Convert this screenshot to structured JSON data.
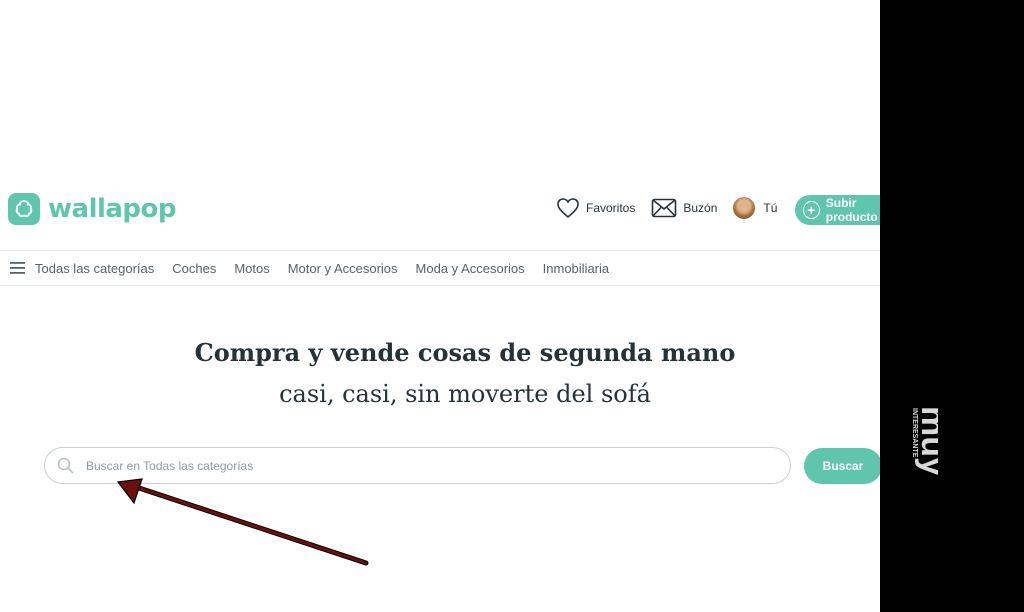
{
  "header": {
    "logo_text": "wallapop",
    "favorites_label": "Favoritos",
    "inbox_label": "Buzón",
    "user_label": "Tú",
    "upload_label": "Subir producto"
  },
  "nav": {
    "all_categories": "Todas las categorías",
    "categories": [
      "Coches",
      "Motos",
      "Motor y Accesorios",
      "Moda y Accesorios",
      "Inmobiliaria"
    ]
  },
  "hero": {
    "title": "Compra y vende cosas de segunda mano",
    "subtitle": "casi, casi, sin moverte del sofá"
  },
  "search": {
    "placeholder": "Buscar en Todas las categorías",
    "value": "",
    "button_label": "Buscar"
  },
  "colors": {
    "brand": "#5fc6ad",
    "arrow": "#6b0f0f",
    "side_bar": "#000000"
  },
  "icons": {
    "logo": "wallapop-logo-icon",
    "favorites": "heart-icon",
    "inbox": "envelope-icon",
    "menu": "hamburger-icon",
    "search": "search-icon",
    "upload": "plus-circle-icon"
  },
  "watermark": "muy interesante"
}
